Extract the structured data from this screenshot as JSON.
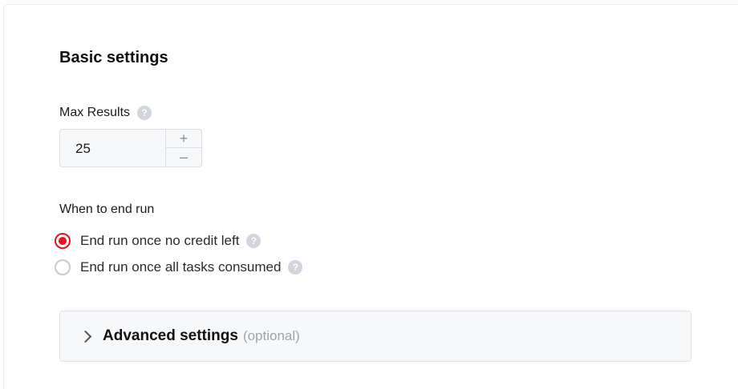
{
  "basic_settings": {
    "title": "Basic settings"
  },
  "max_results": {
    "label": "Max Results",
    "value": "25",
    "increment_symbol": "+",
    "decrement_symbol": "–"
  },
  "end_run": {
    "label": "When to end run",
    "options": [
      {
        "label": "End run once no credit left",
        "selected": true
      },
      {
        "label": "End run once all tasks consumed",
        "selected": false
      }
    ]
  },
  "help_symbol": "?",
  "advanced": {
    "title": "Advanced settings",
    "optional_note": "(optional)"
  },
  "colors": {
    "accent": "#e4141b"
  }
}
